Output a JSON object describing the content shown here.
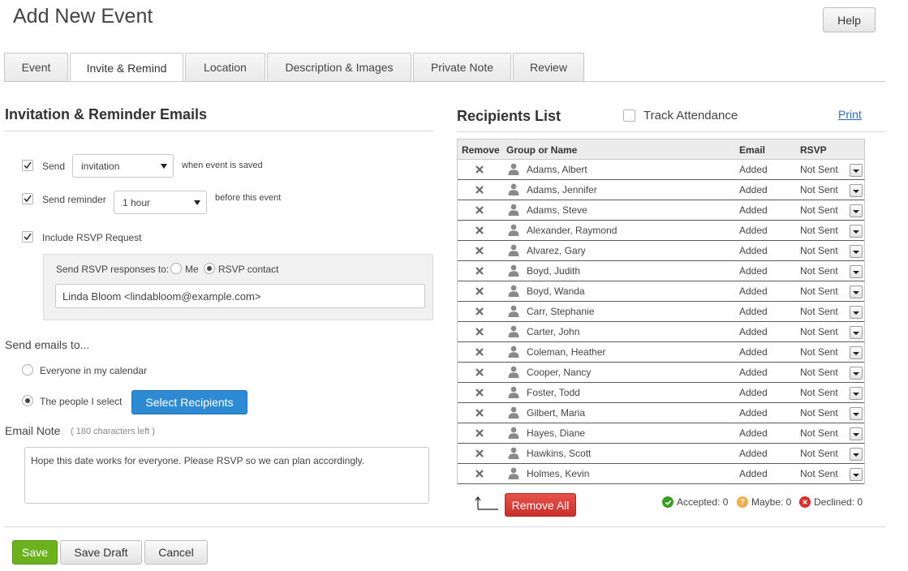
{
  "page": {
    "title": "Add New Event",
    "help_label": "Help"
  },
  "tabs": [
    {
      "label": "Event",
      "active": false
    },
    {
      "label": "Invite & Remind",
      "active": true
    },
    {
      "label": "Location",
      "active": false
    },
    {
      "label": "Description & Images",
      "active": false
    },
    {
      "label": "Private Note",
      "active": false
    },
    {
      "label": "Review",
      "active": false
    }
  ],
  "invitation": {
    "heading": "Invitation & Reminder Emails",
    "send_label": "Send",
    "send_checked": true,
    "send_select_value": "invitation",
    "send_suffix": "when event is saved",
    "reminder_label": "Send reminder",
    "reminder_checked": true,
    "reminder_select_value": "1 hour",
    "reminder_suffix": "before this event",
    "rsvp_label": "Include RSVP Request",
    "rsvp_checked": true,
    "rsvp_to_label": "Send RSVP responses to:",
    "rsvp_option_me": "Me",
    "rsvp_option_contact": "RSVP contact",
    "rsvp_selected": "RSVP contact",
    "rsvp_contact_value": "Linda Bloom <lindabloom@example.com>"
  },
  "send_to": {
    "heading": "Send emails to...",
    "option_everyone": "Everyone in my calendar",
    "option_people": "The people I select",
    "selected": "The people I select",
    "select_button": "Select Recipients"
  },
  "email_note": {
    "label": "Email Note",
    "chars_left": "( 180 characters left )",
    "value": "Hope this date works for everyone.  Please RSVP so we can plan accordingly."
  },
  "recipients": {
    "heading": "Recipients List",
    "track_attendance_label": "Track Attendance",
    "track_attendance_checked": false,
    "print_label": "Print",
    "columns": {
      "remove": "Remove",
      "name": "Group or Name",
      "email": "Email",
      "rsvp": "RSVP"
    },
    "rows": [
      {
        "name": "Adams, Albert",
        "email": "Added",
        "rsvp": "Not Sent"
      },
      {
        "name": "Adams, Jennifer",
        "email": "Added",
        "rsvp": "Not Sent"
      },
      {
        "name": "Adams, Steve",
        "email": "Added",
        "rsvp": "Not Sent"
      },
      {
        "name": "Alexander, Raymond",
        "email": "Added",
        "rsvp": "Not Sent"
      },
      {
        "name": "Alvarez, Gary",
        "email": "Added",
        "rsvp": "Not Sent"
      },
      {
        "name": "Boyd, Judith",
        "email": "Added",
        "rsvp": "Not Sent"
      },
      {
        "name": "Boyd, Wanda",
        "email": "Added",
        "rsvp": "Not Sent"
      },
      {
        "name": "Carr, Stephanie",
        "email": "Added",
        "rsvp": "Not Sent"
      },
      {
        "name": "Carter, John",
        "email": "Added",
        "rsvp": "Not Sent"
      },
      {
        "name": "Coleman, Heather",
        "email": "Added",
        "rsvp": "Not Sent"
      },
      {
        "name": "Cooper, Nancy",
        "email": "Added",
        "rsvp": "Not Sent"
      },
      {
        "name": "Foster, Todd",
        "email": "Added",
        "rsvp": "Not Sent"
      },
      {
        "name": "Gilbert, Maria",
        "email": "Added",
        "rsvp": "Not Sent"
      },
      {
        "name": "Hayes, Diane",
        "email": "Added",
        "rsvp": "Not Sent"
      },
      {
        "name": "Hawkins, Scott",
        "email": "Added",
        "rsvp": "Not Sent"
      },
      {
        "name": "Holmes, Kevin",
        "email": "Added",
        "rsvp": "Not Sent"
      }
    ],
    "remove_all_label": "Remove All",
    "stats": {
      "accepted": "Accepted: 0",
      "maybe": "Maybe: 0",
      "declined": "Declined: 0"
    }
  },
  "footer": {
    "save": "Save",
    "save_draft": "Save Draft",
    "cancel": "Cancel"
  },
  "colors": {
    "accent_blue": "#2d8ad3",
    "save_green": "#6cb11e",
    "remove_red": "#d9534f",
    "accepted": "#3a9d23",
    "maybe": "#f0ad4e",
    "declined": "#d9302c"
  },
  "icons": {
    "remove": "close-icon",
    "person": "person-icon",
    "check": "check-icon",
    "accepted": "check-circle-icon",
    "maybe": "question-circle-icon",
    "declined": "x-circle-icon",
    "arrow": "corner-arrow-icon"
  }
}
